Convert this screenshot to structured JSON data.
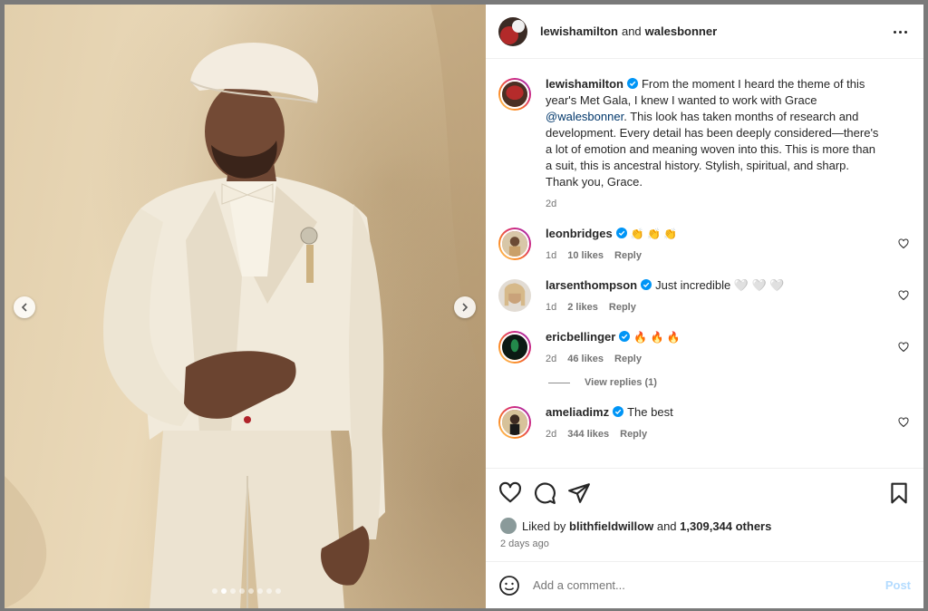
{
  "post": {
    "header": {
      "author": "lewishamilton",
      "conjunction": "and",
      "coauthor": "walesbonner"
    },
    "caption": {
      "username": "lewishamilton",
      "text_before_mention": "From the moment I heard the theme of this year's Met Gala, I knew I wanted to work with Grace ",
      "mention": "@walesbonner",
      "text_after_mention": ". This look has taken months of research and development. Every detail has been deeply considered—there's a lot of emotion and meaning woven into this. This is more than a suit, this is ancestral history. Stylish, spiritual, and sharp. Thank you, Grace.",
      "time": "2d"
    },
    "comments": [
      {
        "username": "leonbridges",
        "text": "👏 👏 👏",
        "time": "1d",
        "likes": "10 likes",
        "reply_label": "Reply"
      },
      {
        "username": "larsenthompson",
        "text": "Just incredible 🤍 🤍 🤍",
        "time": "1d",
        "likes": "2 likes",
        "reply_label": "Reply"
      },
      {
        "username": "ericbellinger",
        "text": "🔥 🔥 🔥",
        "time": "2d",
        "likes": "46 likes",
        "reply_label": "Reply",
        "view_replies": "View replies (1)"
      },
      {
        "username": "ameliadimz",
        "text": "The best",
        "time": "2d",
        "likes": "344 likes",
        "reply_label": "Reply"
      }
    ],
    "liked_by": {
      "prefix": "Liked by",
      "user": "blithfieldwillow",
      "conjunction": "and",
      "count": "1,309,344 others"
    },
    "posted_time": "2 days ago",
    "add_comment": {
      "placeholder": "Add a comment...",
      "post_label": "Post"
    },
    "carousel": {
      "slide_count": 8,
      "active_index": 1
    }
  },
  "colors": {
    "link": "#00376b",
    "verified": "#0095f6",
    "meta": "#737373",
    "post_button": "#b3dbff",
    "suit": "#efe7d6",
    "backdrop": "#e2cfac"
  },
  "icons": {
    "nav_left": "chevron-left-icon",
    "nav_right": "chevron-right-icon",
    "more": "more-options-icon",
    "like": "heart-icon",
    "comment": "comment-icon",
    "share": "share-icon",
    "save": "bookmark-icon",
    "emoji": "emoji-icon",
    "verified": "verified-badge-icon"
  }
}
